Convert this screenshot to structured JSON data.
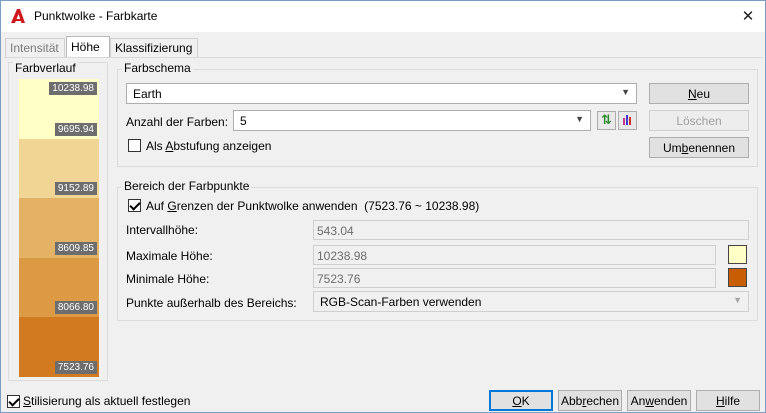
{
  "window": {
    "title": "Punktwolke - Farbkarte",
    "close_glyph": "✕"
  },
  "tabs": [
    {
      "label": "Intensität",
      "state": "disabled"
    },
    {
      "label": "Höhe",
      "state": "active"
    },
    {
      "label": "Klassifizierung",
      "state": "normal"
    }
  ],
  "gradient": {
    "label": "Farbverlauf",
    "bands": [
      {
        "color": "#ffffc6",
        "label": "10238.98"
      },
      {
        "color": "#f1d595",
        "label": "9695.94"
      },
      {
        "color": "#e4b265",
        "label": "9152.89"
      },
      {
        "color": "#dc9a45",
        "label": "8609.85"
      },
      {
        "color": "#d27a1f",
        "label": "8066.80"
      },
      {
        "color": "#c85d04",
        "label": "7523.76"
      }
    ]
  },
  "scheme": {
    "label": "Farbschema",
    "selected": "Earth",
    "color_count_label": "Anzahl der Farben:",
    "color_count": "5",
    "show_steps_label_pre": "Als ",
    "show_steps_label_key": "A",
    "show_steps_label_post": "bstufung anzeigen",
    "show_steps_checked": false,
    "new_button_key": "N",
    "new_button_rest": "eu",
    "delete_button": "Löschen",
    "rename_button_pre": "Um",
    "rename_button_key": "b",
    "rename_button_post": "enennen",
    "swap_icon": "⇅"
  },
  "range": {
    "label": "Bereich der Farbpunkte",
    "bounds_checked": true,
    "bounds_label_pre": "Auf ",
    "bounds_label_key": "G",
    "bounds_label_post": "renzen der Punktwolke anwenden",
    "bounds_range": "(7523.76 ~ 10238.98)",
    "interval_label": "Intervallhöhe:",
    "interval_value": "543.04",
    "max_label": "Maximale Höhe:",
    "max_value": "10238.98",
    "max_color": "#ffffc6",
    "min_label": "Minimale Höhe:",
    "min_value": "7523.76",
    "min_color": "#c85d04",
    "outside_label": "Punkte außerhalb des Bereichs:",
    "outside_value": "RGB-Scan-Farben verwenden"
  },
  "footer": {
    "set_current_checked": true,
    "set_current_key": "S",
    "set_current_rest": "tilisierung als aktuell festlegen",
    "ok_key": "O",
    "ok_rest": "K",
    "cancel_pre": "Abb",
    "cancel_key": "r",
    "cancel_post": "echen",
    "apply_pre": "An",
    "apply_key": "w",
    "apply_post": "enden",
    "help_key": "H",
    "help_rest": "ilfe"
  },
  "colors": {
    "accent": "#0078d7",
    "autocad_red": "#d0191e"
  }
}
